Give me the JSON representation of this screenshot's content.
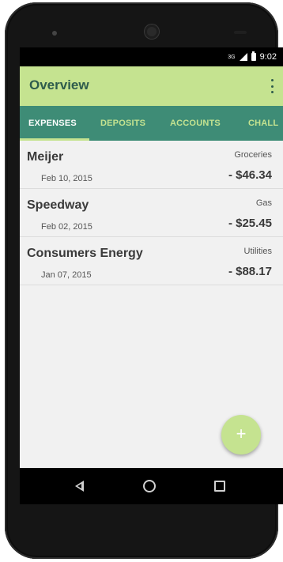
{
  "status_bar": {
    "network": "3G",
    "time": "9:02"
  },
  "app_bar": {
    "title": "Overview",
    "menu_icon": "more-vert-icon"
  },
  "tabs": [
    {
      "label": "EXPENSES",
      "active": true
    },
    {
      "label": "DEPOSITS",
      "active": false
    },
    {
      "label": "ACCOUNTS",
      "active": false
    },
    {
      "label": "CHALL",
      "active": false
    }
  ],
  "expenses": [
    {
      "merchant": "Meijer",
      "category": "Groceries",
      "date": "Feb 10, 2015",
      "amount": "- $46.34"
    },
    {
      "merchant": "Speedway",
      "category": "Gas",
      "date": "Feb 02, 2015",
      "amount": "- $25.45"
    },
    {
      "merchant": "Consumers Energy",
      "category": "Utilities",
      "date": "Jan 07, 2015",
      "amount": "- $88.17"
    }
  ],
  "fab": {
    "label": "+"
  },
  "colors": {
    "app_bar": "#c5e390",
    "tab_bar": "#3e8c76",
    "title_text": "#2e5c4c"
  }
}
